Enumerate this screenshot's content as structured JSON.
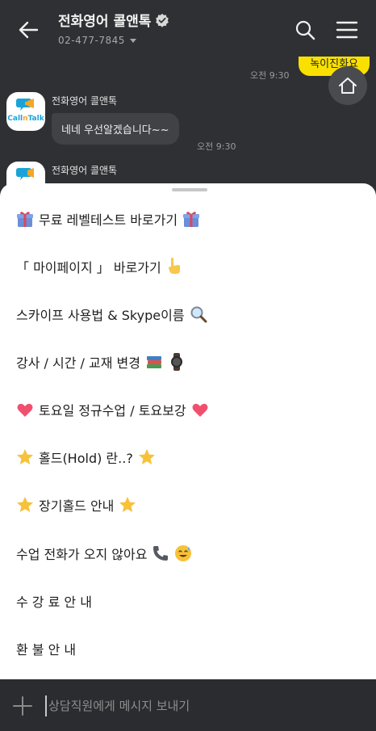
{
  "header": {
    "title": "전화영어 콜앤톡",
    "phone": "02-477-7845"
  },
  "chat": {
    "sent_message": "녹이진화요",
    "sent_time": "오전 9:30",
    "sender_name": "전화영어 콜앤톡",
    "avatar_brand_1": "Call",
    "avatar_brand_2": "n",
    "avatar_brand_3": "Talk",
    "received_message": "네네 우선알겠습니다~~",
    "received_time": "오전 9:30",
    "sender_name_2": "전화영어 콜앤톡"
  },
  "menu_items": [
    "무료 레벨테스트 바로가기",
    "「 마이페이지 」 바로가기",
    "스카이프 사용법 & Skype이름",
    "강사 / 시간 / 교재 변경",
    "토요일 정규수업 / 토요보강",
    "홀드(Hold) 란..?",
    "장기홀드 안내",
    "수업 전화가 오지 않아요",
    "수 강 료 안 내",
    "환 불 안 내"
  ],
  "input": {
    "placeholder": "상담직원에게 메시지 보내기"
  },
  "colors": {
    "header_bg": "#2f3033",
    "sent_bubble": "#f9e000",
    "received_bubble": "#414246",
    "sheet_bg": "#ffffff",
    "input_bg": "#2b2c2f"
  }
}
